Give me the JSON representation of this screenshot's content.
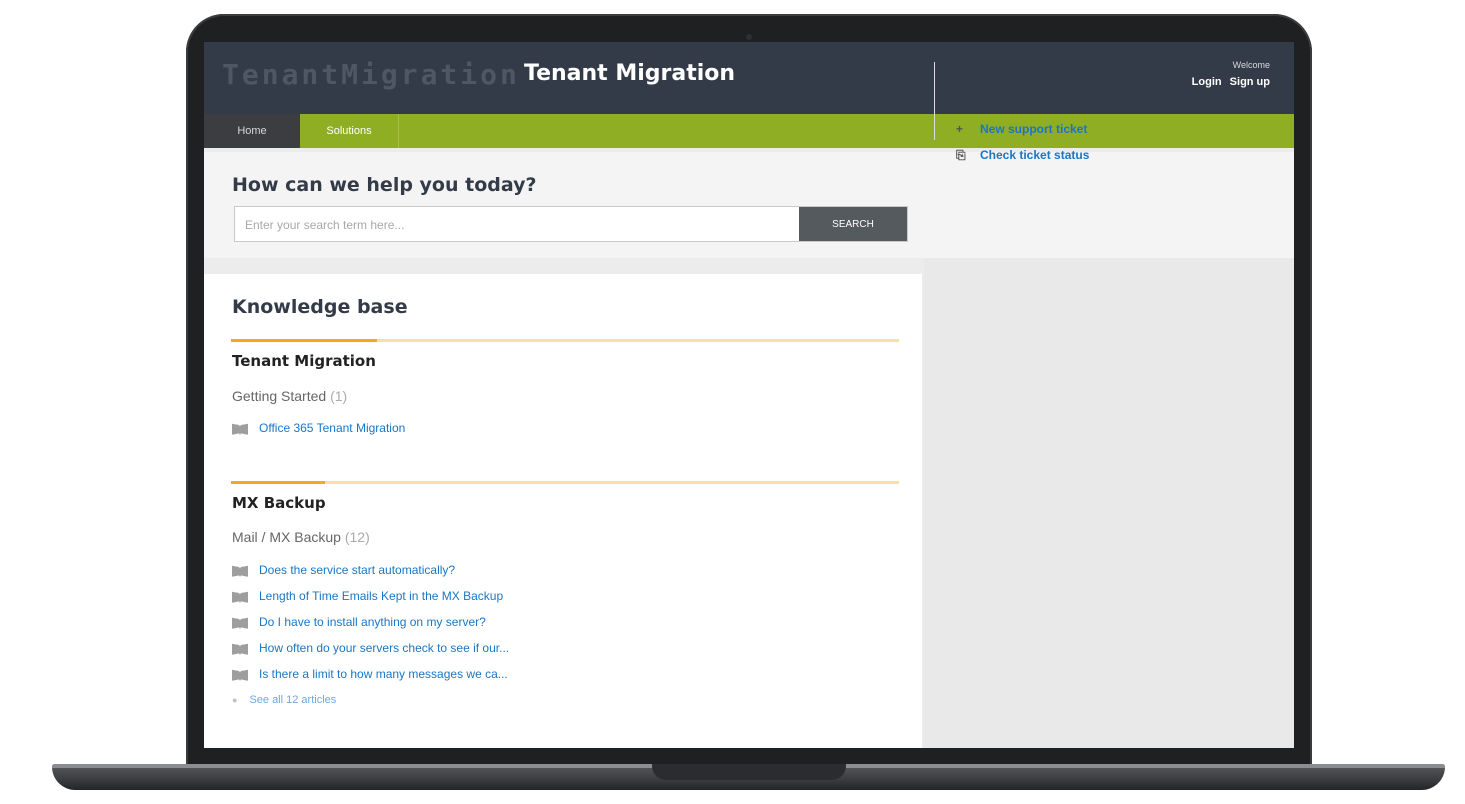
{
  "header": {
    "logo_text": "TenantMigration",
    "site_title": "Tenant Migration",
    "welcome": "Welcome",
    "login_label": "Login",
    "signup_label": "Sign up"
  },
  "nav": {
    "tabs": [
      {
        "label": "Home",
        "active": true
      },
      {
        "label": "Solutions",
        "active": false
      }
    ]
  },
  "help": {
    "title": "How can we help you today?",
    "search_placeholder": "Enter your search term here...",
    "search_button": "SEARCH"
  },
  "actions": {
    "new_ticket": {
      "label": "New support ticket",
      "icon": "plus-icon"
    },
    "check_status": {
      "label": "Check ticket status",
      "icon": "ticket-icon"
    }
  },
  "knowledge_base": {
    "heading": "Knowledge base",
    "sections": [
      {
        "title": "Tenant Migration",
        "folder": "Getting Started",
        "folder_count": "(1)",
        "articles": [
          "Office 365 Tenant Migration"
        ]
      },
      {
        "title": "MX Backup",
        "folder": "Mail / MX Backup",
        "folder_count": "(12)",
        "articles": [
          "Does the service start automatically?",
          "Length of Time Emails Kept in the MX Backup",
          "Do I have to install anything on my server?",
          "How often do your servers check to see if our...",
          "Is there a limit to how many messages we ca..."
        ],
        "see_all": "See all 12 articles"
      }
    ]
  },
  "colors": {
    "header_bg": "#333b48",
    "nav_green": "#8fae24",
    "link_blue": "#1a76c4",
    "accent_orange": "#f4a71f"
  }
}
